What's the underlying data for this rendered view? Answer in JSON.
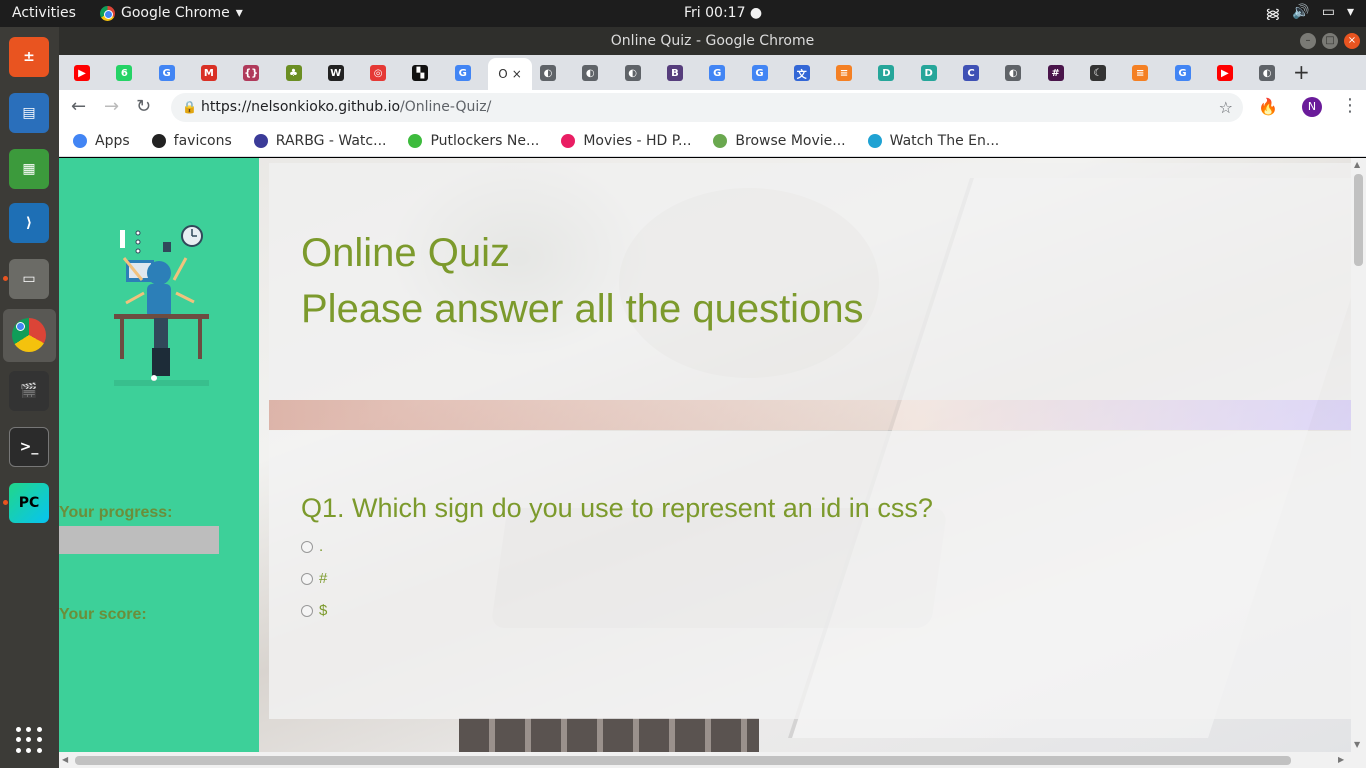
{
  "topbar": {
    "activities": "Activities",
    "app_name": "Google Chrome",
    "clock": "Fri 00:17 ●"
  },
  "window": {
    "title": "Online Quiz - Google Chrome"
  },
  "tabs": {
    "active_label": "O",
    "favicons": [
      {
        "icon": "youtube-icon",
        "color": "#ff0000",
        "glyph": "▶"
      },
      {
        "icon": "whatsapp-icon",
        "color": "#25d366",
        "glyph": "6"
      },
      {
        "icon": "google-icon",
        "color": "#4285f4",
        "glyph": "G"
      },
      {
        "icon": "gmail-icon",
        "color": "#d93025",
        "glyph": "M"
      },
      {
        "icon": "brackets-icon",
        "color": "#b03a5b",
        "glyph": "{}"
      },
      {
        "icon": "tree-icon",
        "color": "#6b8e23",
        "glyph": "♣"
      },
      {
        "icon": "wikipedia-icon",
        "color": "#222222",
        "glyph": "W"
      },
      {
        "icon": "target-icon",
        "color": "#e53935",
        "glyph": "◎"
      },
      {
        "icon": "ubuntu-icon",
        "color": "#111111",
        "glyph": "▚"
      },
      {
        "icon": "google-icon",
        "color": "#4285f4",
        "glyph": "G"
      }
    ],
    "favicons_right": [
      {
        "icon": "globe-icon",
        "color": "#5f6368",
        "glyph": "◐"
      },
      {
        "icon": "globe-icon",
        "color": "#5f6368",
        "glyph": "◐"
      },
      {
        "icon": "globe-icon",
        "color": "#5f6368",
        "glyph": "◐"
      },
      {
        "icon": "bootstrap-icon",
        "color": "#563d7c",
        "glyph": "B"
      },
      {
        "icon": "google-icon",
        "color": "#4285f4",
        "glyph": "G"
      },
      {
        "icon": "google-icon",
        "color": "#4285f4",
        "glyph": "G"
      },
      {
        "icon": "translate-icon",
        "color": "#3367d6",
        "glyph": "文"
      },
      {
        "icon": "stackoverflow-icon",
        "color": "#f48024",
        "glyph": "≡"
      },
      {
        "icon": "d-icon",
        "color": "#26a69a",
        "glyph": "D"
      },
      {
        "icon": "d-icon",
        "color": "#26a69a",
        "glyph": "D"
      },
      {
        "icon": "c-icon",
        "color": "#3f51b5",
        "glyph": "C"
      },
      {
        "icon": "globe-icon",
        "color": "#5f6368",
        "glyph": "◐"
      },
      {
        "icon": "slack-icon",
        "color": "#4a154b",
        "glyph": "#"
      },
      {
        "icon": "moon-icon",
        "color": "#333333",
        "glyph": "☾"
      },
      {
        "icon": "stackoverflow-icon",
        "color": "#f48024",
        "glyph": "≡"
      },
      {
        "icon": "google-icon",
        "color": "#4285f4",
        "glyph": "G"
      },
      {
        "icon": "youtube-icon",
        "color": "#ff0000",
        "glyph": "▶"
      },
      {
        "icon": "globe-icon",
        "color": "#5f6368",
        "glyph": "◐"
      }
    ]
  },
  "toolbar": {
    "url_host": "https://nelsonkioko.github.io",
    "url_path": "/Online-Quiz/",
    "profile_initial": "N"
  },
  "bookmarks": [
    {
      "label": "Apps",
      "icon": "apps-grid-icon",
      "color": "#4285f4"
    },
    {
      "label": "favicons",
      "icon": "favicons-icon",
      "color": "#222222"
    },
    {
      "label": "RARBG - Watc...",
      "icon": "rarbg-icon",
      "color": "#3b3b98"
    },
    {
      "label": "Putlockers Ne...",
      "icon": "play-icon",
      "color": "#3dbb3d"
    },
    {
      "label": "Movies - HD P...",
      "icon": "popcorn-icon",
      "color": "#e91e63"
    },
    {
      "label": "Browse Movie...",
      "icon": "yts-icon",
      "color": "#6aa84f"
    },
    {
      "label": "Watch The En...",
      "icon": "play-circle-icon",
      "color": "#1fa2d3"
    }
  ],
  "page": {
    "title": "Online Quiz",
    "subtitle": "Please answer all the questions",
    "progress_label": "Your progress:",
    "progress_value": 0,
    "score_label": "Your score:",
    "question": "Q1. Which sign do you use to represent an id in css?",
    "options": [
      ".",
      "#",
      "$"
    ]
  },
  "colors": {
    "sidebar": "#3dd099",
    "accent_text": "#7c9a2c",
    "dock": "#3c3b37",
    "ubuntu_orange": "#e95420"
  }
}
